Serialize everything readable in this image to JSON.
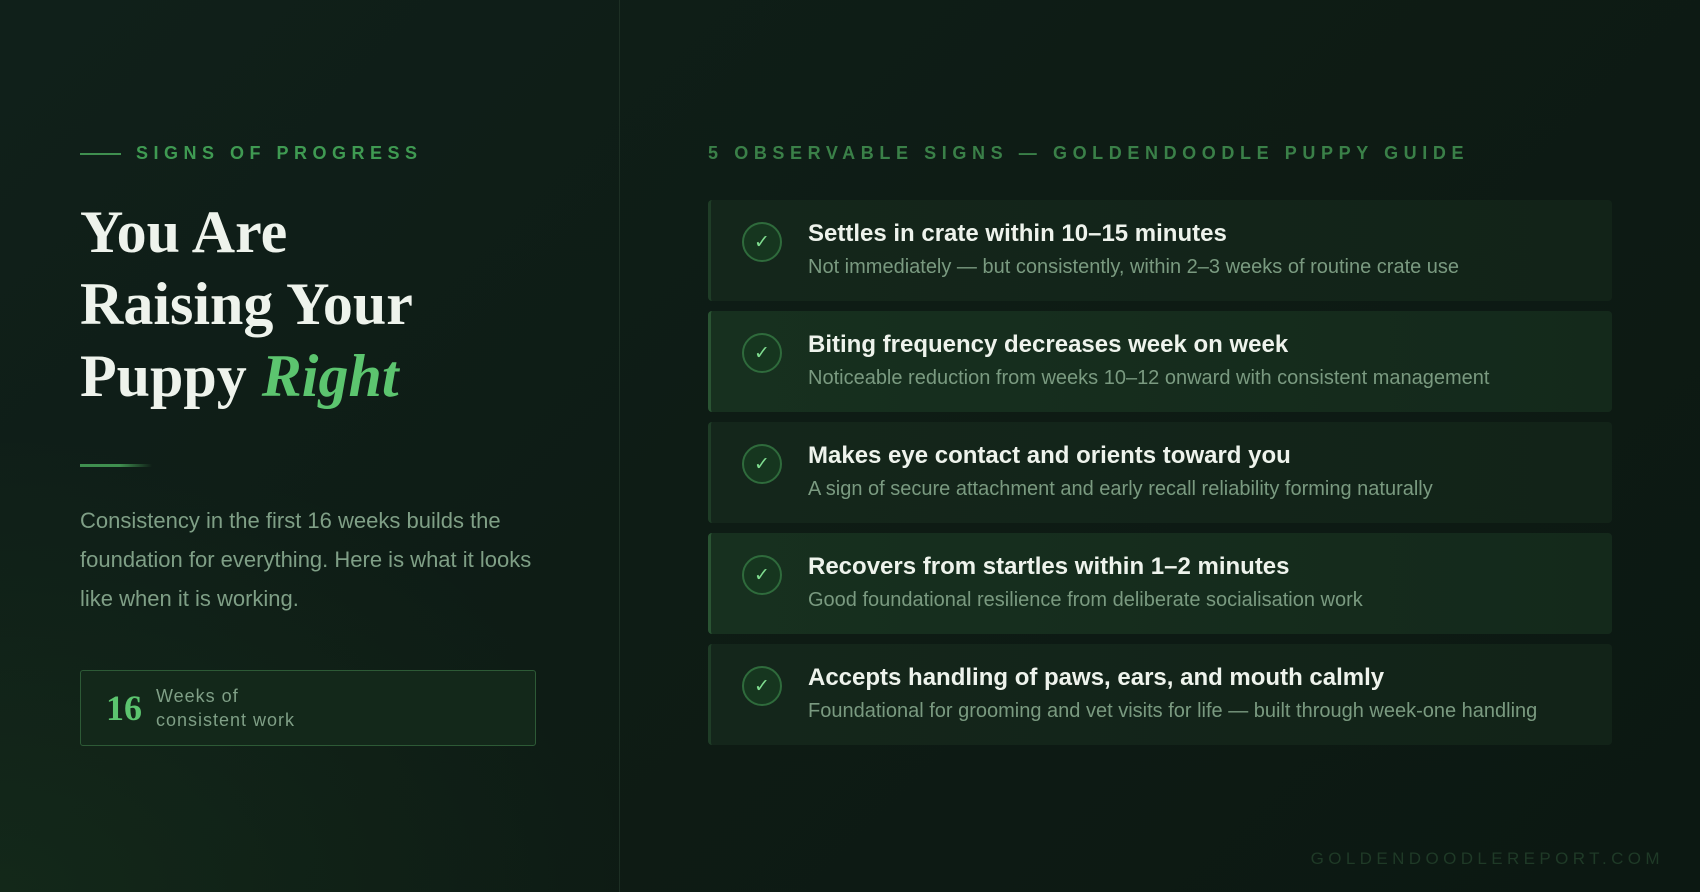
{
  "left": {
    "eyebrow": "SIGNS OF PROGRESS",
    "headline": {
      "line1": "You Are",
      "line2": "Raising Your",
      "line3_plain": "Puppy ",
      "line3_accent": "Right"
    },
    "intro": "Consistency in the first 16 weeks builds the foundation for everything. Here is what it looks like when it is working.",
    "stat": {
      "number": "16",
      "label": "Weeks of consistent work"
    }
  },
  "right": {
    "eyebrow": "5 OBSERVABLE SIGNS — GOLDENDOODLE PUPPY GUIDE",
    "check_glyph": "✓",
    "signs": [
      {
        "title": "Settles in crate within 10–15 minutes",
        "desc": "Not immediately — but consistently, within 2–3 weeks of routine crate use"
      },
      {
        "title": "Biting frequency decreases week on week",
        "desc": "Noticeable reduction from weeks 10–12 onward with consistent management"
      },
      {
        "title": "Makes eye contact and orients toward you",
        "desc": "A sign of secure attachment and early recall reliability forming naturally"
      },
      {
        "title": "Recovers from startles within 1–2 minutes",
        "desc": "Good foundational resilience from deliberate socialisation work"
      },
      {
        "title": "Accepts handling of paws, ears, and mouth calmly",
        "desc": "Foundational for grooming and vet visits for life — built through week-one handling"
      }
    ]
  },
  "footer": "GOLDENDOODLEREPORT.COM",
  "colors": {
    "background": "#0d1a13",
    "accent": "#5cc56f",
    "eyebrow": "#3f9a52",
    "heading": "#eef3ec",
    "muted": "#7f9f86"
  },
  "icons": {
    "sign": "check-circle-icon"
  }
}
